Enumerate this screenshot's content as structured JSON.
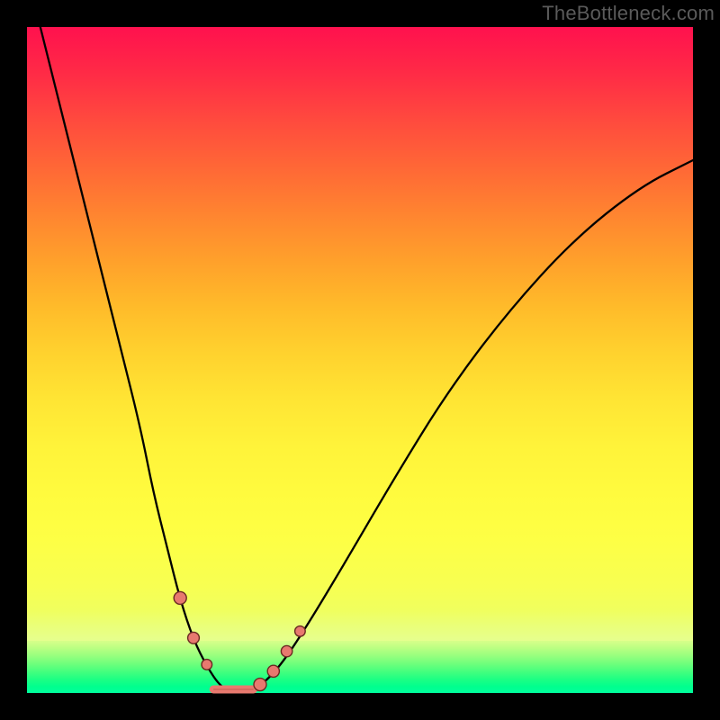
{
  "watermark": "TheBottleneck.com",
  "chart_data": {
    "type": "line",
    "title": "",
    "xlabel": "",
    "ylabel": "",
    "x_range": [
      0,
      100
    ],
    "y_range": [
      0,
      100
    ],
    "grid": false,
    "legend": false,
    "series": [
      {
        "name": "curve",
        "description": "V-shaped bottleneck curve descending steeply from top-left, flattening near x≈25–35 at the baseline, then rising to the right edge",
        "x": [
          2,
          5,
          8,
          11,
          14,
          17,
          19,
          21,
          23,
          25,
          27,
          29,
          31,
          33,
          35,
          38,
          42,
          48,
          55,
          63,
          72,
          82,
          92,
          100
        ],
        "y": [
          100,
          88,
          76,
          64,
          52,
          40,
          30,
          22,
          14,
          8,
          4,
          1,
          0,
          0,
          1,
          4,
          10,
          20,
          32,
          45,
          57,
          68,
          76,
          80
        ]
      }
    ],
    "markers": {
      "description": "salmon beads clustered along both arms near the trough, with a short flat salmon segment at the bottom",
      "left_arm_beads": [
        {
          "x": 23,
          "y": 14
        },
        {
          "x": 25,
          "y": 8
        },
        {
          "x": 27,
          "y": 4
        }
      ],
      "right_arm_beads": [
        {
          "x": 35,
          "y": 1
        },
        {
          "x": 37,
          "y": 3
        },
        {
          "x": 39,
          "y": 6
        },
        {
          "x": 41,
          "y": 9
        }
      ],
      "flat_segment": {
        "x0": 28,
        "x1": 34,
        "y": 0
      }
    },
    "background_gradient": {
      "top": "#ff114e",
      "mid": "#fff33a",
      "bottom": "#00ff9d"
    }
  }
}
